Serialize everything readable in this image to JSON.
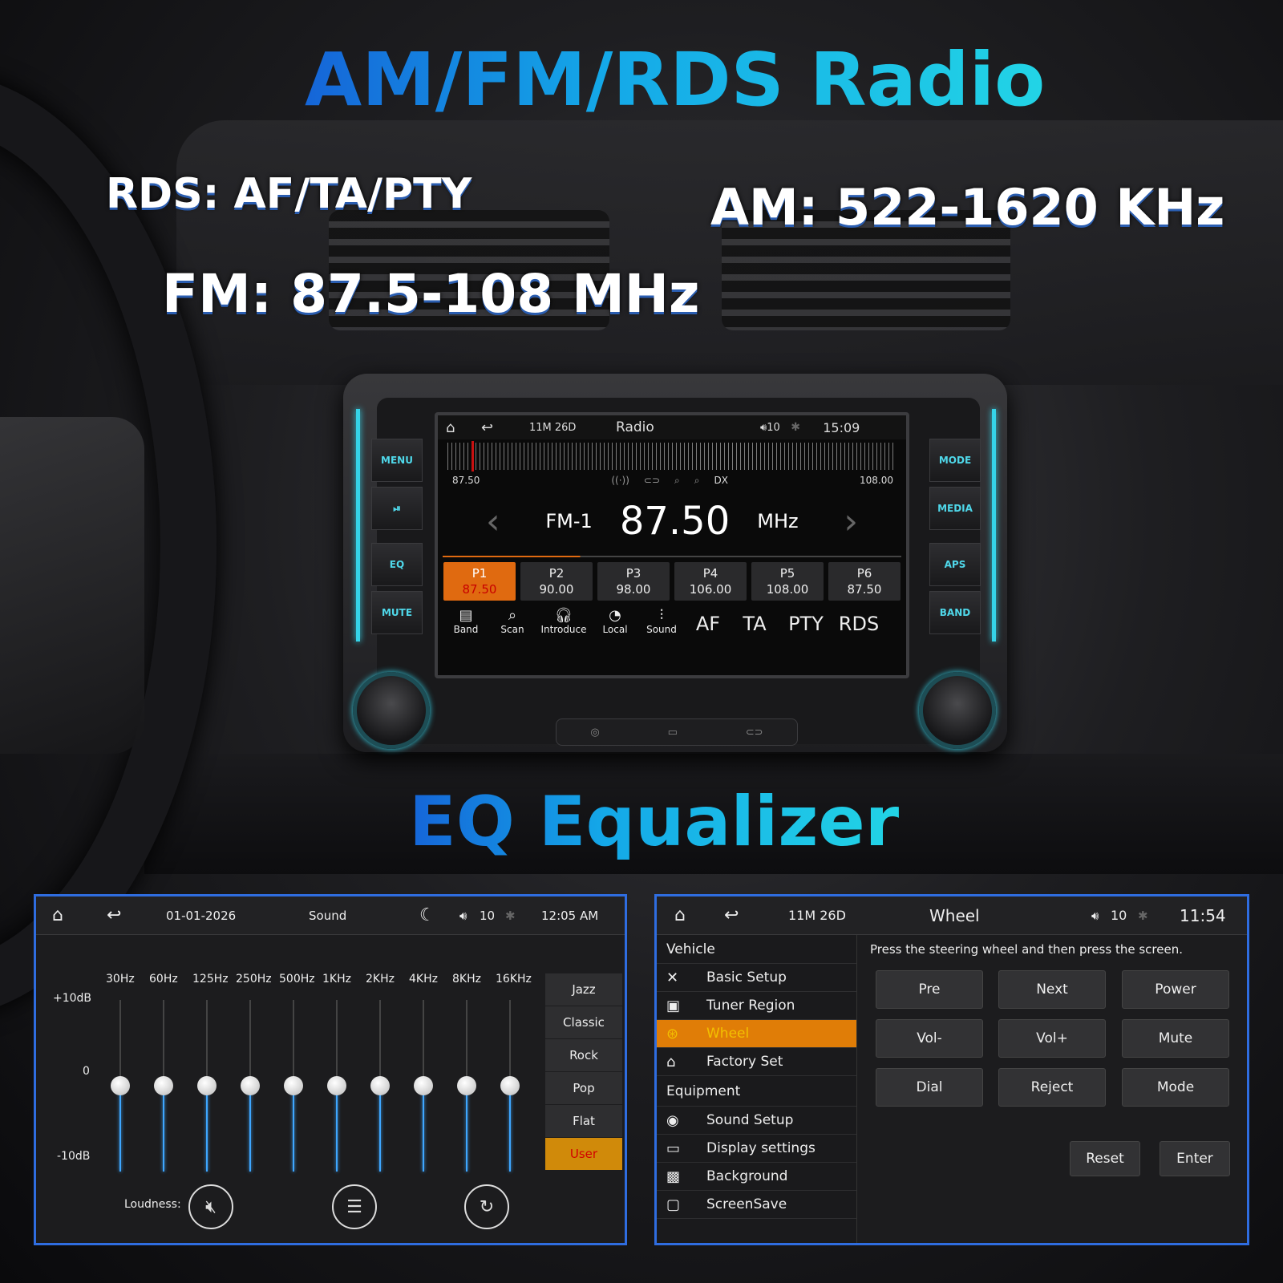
{
  "headline": "AM/FM/RDS Radio",
  "specs": {
    "rds": "RDS: AF/TA/PTY",
    "am": "AM: 522-1620 KHz",
    "fm": "FM: 87.5-108 MHz"
  },
  "eq_headline": "EQ Equalizer",
  "side_buttons": {
    "left": [
      "MENU",
      "⏯",
      "EQ",
      "MUTE"
    ],
    "right": [
      "MODE",
      "MEDIA",
      "APS",
      "BAND"
    ]
  },
  "radio": {
    "date": "11M 26D",
    "title": "Radio",
    "volume": "10",
    "time": "15:09",
    "scale_min": "87.50",
    "scale_max": "108.00",
    "indicators": [
      "((·))",
      "⊂⊃",
      "⌕",
      "⌕",
      "DX"
    ],
    "band": "FM-1",
    "frequency": "87.50",
    "unit": "MHz",
    "presets": [
      {
        "name": "P1",
        "freq": "87.50"
      },
      {
        "name": "P2",
        "freq": "90.00"
      },
      {
        "name": "P3",
        "freq": "98.00"
      },
      {
        "name": "P4",
        "freq": "106.00"
      },
      {
        "name": "P5",
        "freq": "108.00"
      },
      {
        "name": "P6",
        "freq": "87.50"
      }
    ],
    "toolbar": [
      "Band",
      "Scan",
      "Introduce",
      "Local",
      "Sound"
    ],
    "toolbar_text": [
      "AF",
      "TA",
      "PTY",
      "RDS"
    ]
  },
  "sound": {
    "date": "01-01-2026",
    "title": "Sound",
    "volume": "10",
    "time": "12:05 AM",
    "bands": [
      "30Hz",
      "60Hz",
      "125Hz",
      "250Hz",
      "500Hz",
      "1KHz",
      "2KHz",
      "4KHz",
      "8KHz",
      "16KHz"
    ],
    "levels_db": [
      0,
      0,
      0,
      0,
      0,
      0,
      0,
      0,
      0,
      0
    ],
    "y_labels": [
      "+10dB",
      "0",
      "-10dB"
    ],
    "presets": [
      "Jazz",
      "Classic",
      "Rock",
      "Pop",
      "Flat",
      "User"
    ],
    "loudness_label": "Loudness:"
  },
  "wheel": {
    "date": "11M 26D",
    "title": "Wheel",
    "volume": "10",
    "time": "11:54",
    "section_vehicle": "Vehicle",
    "vehicle_items": [
      "Basic Setup",
      "Tuner Region",
      "Wheel",
      "Factory Set"
    ],
    "section_equipment": "Equipment",
    "equipment_items": [
      "Sound Setup",
      "Display settings",
      "Background",
      "ScreenSave"
    ],
    "instruction": "Press the steering wheel and then press the screen.",
    "buttons": [
      "Pre",
      "Next",
      "Power",
      "Vol-",
      "Vol+",
      "Mute",
      "Dial",
      "Reject",
      "Mode"
    ],
    "reset": "Reset",
    "enter": "Enter"
  },
  "colors": {
    "accent_blue": "#2f6de0",
    "cyan": "#35d3e8",
    "orange": "#e07d07",
    "slider": "#3ea6ff"
  }
}
